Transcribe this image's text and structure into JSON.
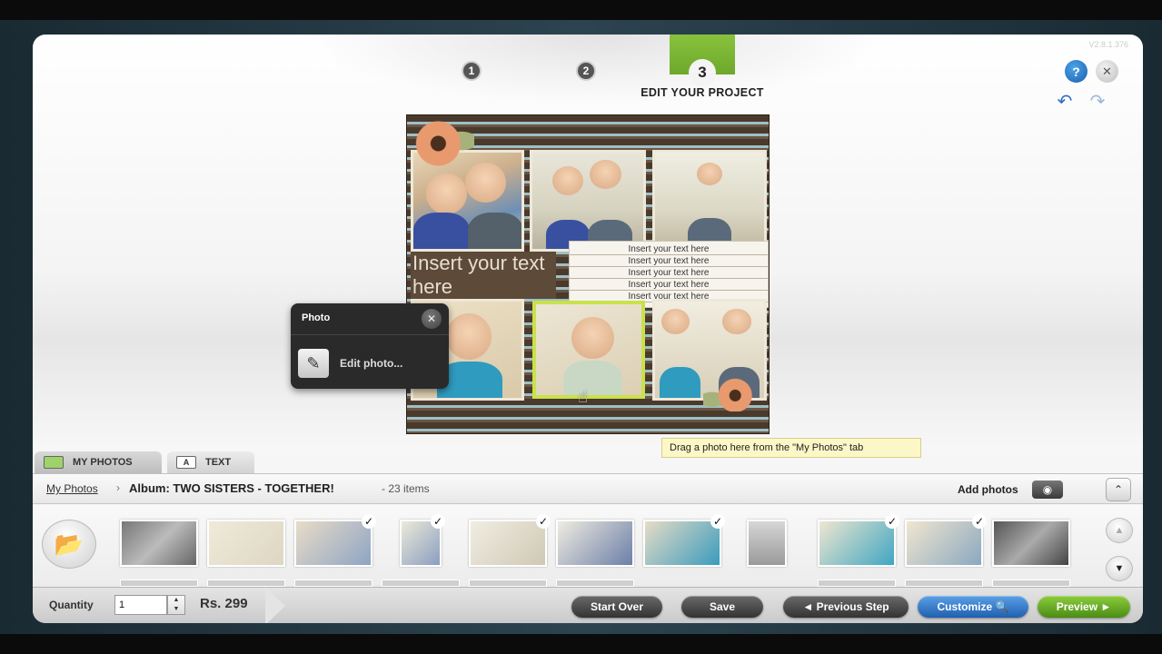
{
  "app": {
    "version": "V2.8.1.376"
  },
  "steps": {
    "step1": "1",
    "step2": "2",
    "step3": "3",
    "current_label": "EDIT YOUR PROJECT"
  },
  "toolbar": {
    "help": "?",
    "close": "✕",
    "undo": "↶",
    "redo": "↷"
  },
  "canvas": {
    "text_big": "Insert your text here",
    "text_lines": [
      "Insert your text here",
      "Insert your text here",
      "Insert your text here",
      "Insert your text here",
      "Insert your text here"
    ],
    "tooltip": "Drag a photo here from the \"My Photos\" tab"
  },
  "popover": {
    "title": "Photo",
    "close": "✕",
    "edit_label": "Edit photo..."
  },
  "tabs": {
    "photos": "MY PHOTOS",
    "text": "TEXT"
  },
  "panel": {
    "breadcrumb_link": "My Photos",
    "breadcrumb_sep": "›",
    "album_title": "Album: TWO SISTERS - TOGETHER!",
    "item_count": "- 23 items",
    "add_photos": "Add photos"
  },
  "thumbnails": [
    {
      "checked": false
    },
    {
      "checked": false
    },
    {
      "checked": true
    },
    {
      "checked": true
    },
    {
      "checked": true
    },
    {
      "checked": false
    },
    {
      "checked": true
    },
    {
      "checked": false
    },
    {
      "checked": true
    },
    {
      "checked": true
    },
    {
      "checked": false
    }
  ],
  "footer": {
    "quantity_label": "Quantity",
    "quantity_value": "1",
    "price": "Rs. 299",
    "start_over": "Start Over",
    "save": "Save",
    "previous_step": "◄ Previous Step",
    "customize": "Customize 🔍",
    "preview": "Preview ►"
  },
  "colors": {
    "accent_green": "#8cc63f",
    "accent_blue": "#1f5fb0",
    "selected_frame": "#c9e24a"
  }
}
